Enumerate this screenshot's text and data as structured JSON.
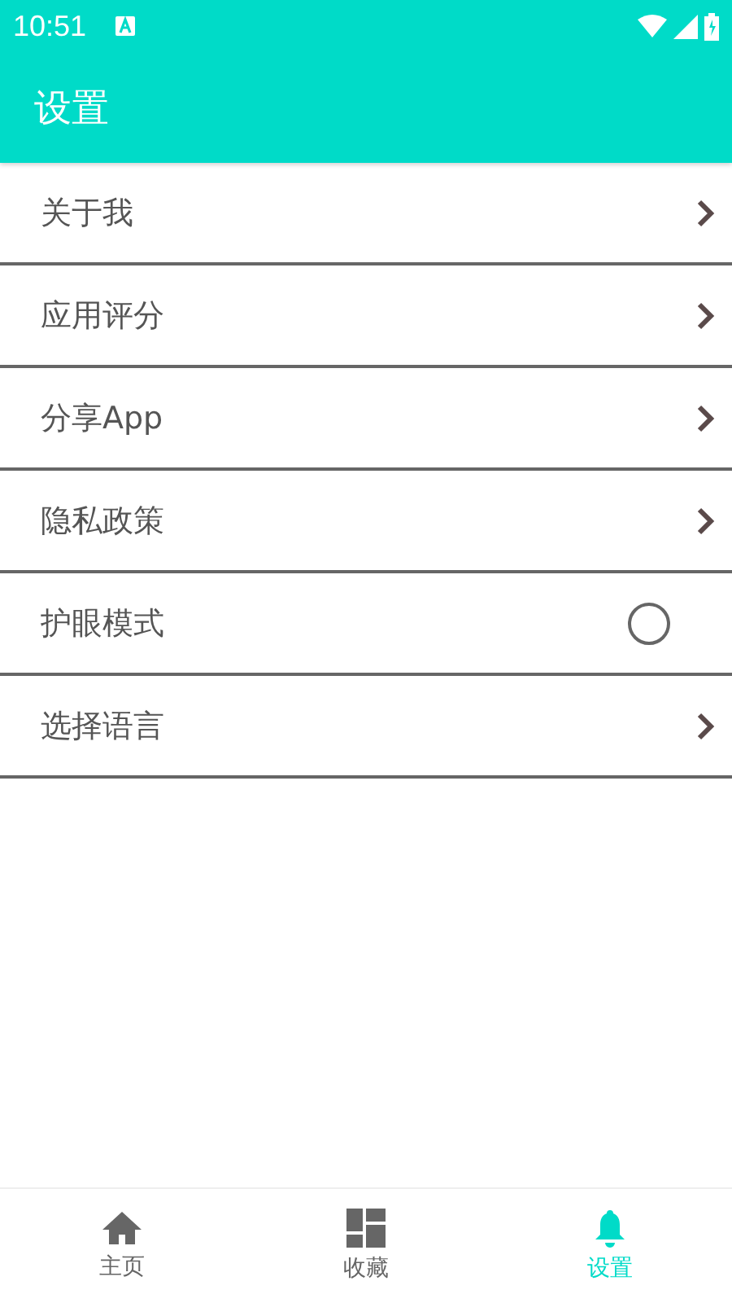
{
  "status_bar": {
    "time": "10:51"
  },
  "app_bar": {
    "title": "设置"
  },
  "settings": [
    {
      "label": "关于我",
      "kind": "link"
    },
    {
      "label": "应用评分",
      "kind": "link"
    },
    {
      "label": "分享App",
      "kind": "link"
    },
    {
      "label": "隐私政策",
      "kind": "link"
    },
    {
      "label": "护眼模式",
      "kind": "toggle",
      "on": false
    },
    {
      "label": "选择语言",
      "kind": "link"
    }
  ],
  "bottom_nav": [
    {
      "label": "主页",
      "kind": "home",
      "selected": false
    },
    {
      "label": "收藏",
      "kind": "grid",
      "selected": false
    },
    {
      "label": "设置",
      "kind": "bell",
      "selected": true
    }
  ]
}
